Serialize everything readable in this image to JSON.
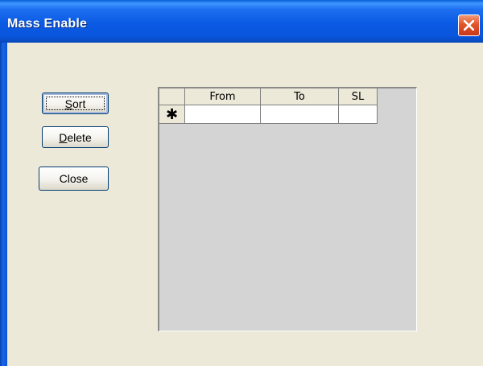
{
  "window": {
    "title": "Mass Enable"
  },
  "buttons": {
    "sort": {
      "label": "Sort",
      "accel": "S"
    },
    "delete": {
      "label": "Delete",
      "accel": "D"
    },
    "close": {
      "label": "Close"
    }
  },
  "grid": {
    "columns": [
      "From",
      "To",
      "SL"
    ],
    "new_row_marker": "✱",
    "rows": [
      {
        "from": "",
        "to": "",
        "sl": ""
      }
    ]
  },
  "colors": {
    "titlebar": "#0a55dd",
    "dialog_bg": "#ece9d8",
    "grid_bg": "#d4d4d4",
    "close_button": "#e2552b"
  }
}
